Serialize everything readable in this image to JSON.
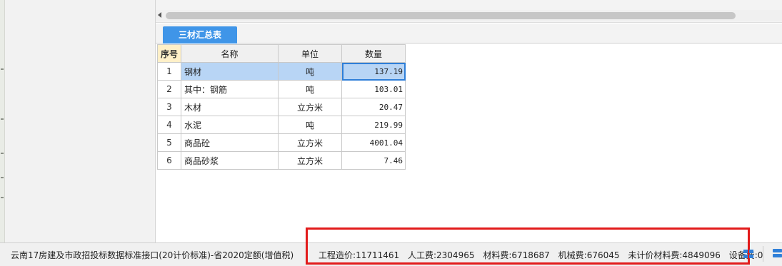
{
  "tabs": [
    {
      "label": "三材汇总表",
      "active": true
    }
  ],
  "table": {
    "columns": [
      "序号",
      "名称",
      "单位",
      "数量"
    ],
    "rows": [
      {
        "seq": "1",
        "name": "钢材",
        "unit": "吨",
        "qty": "137.19",
        "selected": true
      },
      {
        "seq": "2",
        "name": "其中：钢筋",
        "unit": "吨",
        "qty": "103.01"
      },
      {
        "seq": "3",
        "name": "木材",
        "unit": "立方米",
        "qty": "20.47"
      },
      {
        "seq": "4",
        "name": "水泥",
        "unit": "吨",
        "qty": "219.99"
      },
      {
        "seq": "5",
        "name": "商品砼",
        "unit": "立方米",
        "qty": "4001.04"
      },
      {
        "seq": "6",
        "name": "商品砂浆",
        "unit": "立方米",
        "qty": "7.46"
      }
    ]
  },
  "status_bar": {
    "interface_text": "云南17房建及市政招投标数据标准接口(20计价标准)-省2020定额(增值税)",
    "stats": [
      {
        "label": "工程造价",
        "value": "11711461"
      },
      {
        "label": "人工费",
        "value": "2304965"
      },
      {
        "label": "材料费",
        "value": "6718687"
      },
      {
        "label": "机械费",
        "value": "676045"
      },
      {
        "label": "未计价材料费",
        "value": "4849096"
      },
      {
        "label": "设备费",
        "value": "0"
      }
    ]
  },
  "colors": {
    "accent": "#3f95e8",
    "selection": "#b8d5f5",
    "highlight_border": "#e21b1b"
  },
  "icons": [
    "scroll-left-arrow-icon",
    "grid-layout-icon",
    "panel-layout-icon"
  ]
}
